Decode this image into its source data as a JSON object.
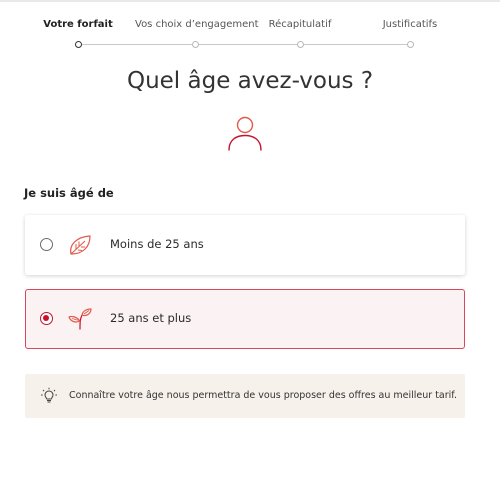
{
  "stepper": {
    "steps": [
      {
        "label": "Votre forfait",
        "active": true
      },
      {
        "label": "Vos choix d’engagement",
        "active": false
      },
      {
        "label": "Récapitulatif",
        "active": false
      },
      {
        "label": "Justificatifs",
        "active": false
      }
    ]
  },
  "page": {
    "title": "Quel âge avez-vous ?",
    "section_label": "Je suis âgé de"
  },
  "options": [
    {
      "label": "Moins de 25 ans",
      "selected": false,
      "icon": "leaf-icon"
    },
    {
      "label": "25 ans et plus",
      "selected": true,
      "icon": "sprout-leaves-icon"
    }
  ],
  "info": {
    "icon": "lightbulb-icon",
    "text": "Connaître votre âge nous permettra de vous proposer des offres au meilleur tarif."
  },
  "colors": {
    "accent": "#c8102e",
    "selected_bg": "#fbf2f3",
    "info_bg": "#f6f1eb",
    "icon_red": "#e05a4a"
  }
}
